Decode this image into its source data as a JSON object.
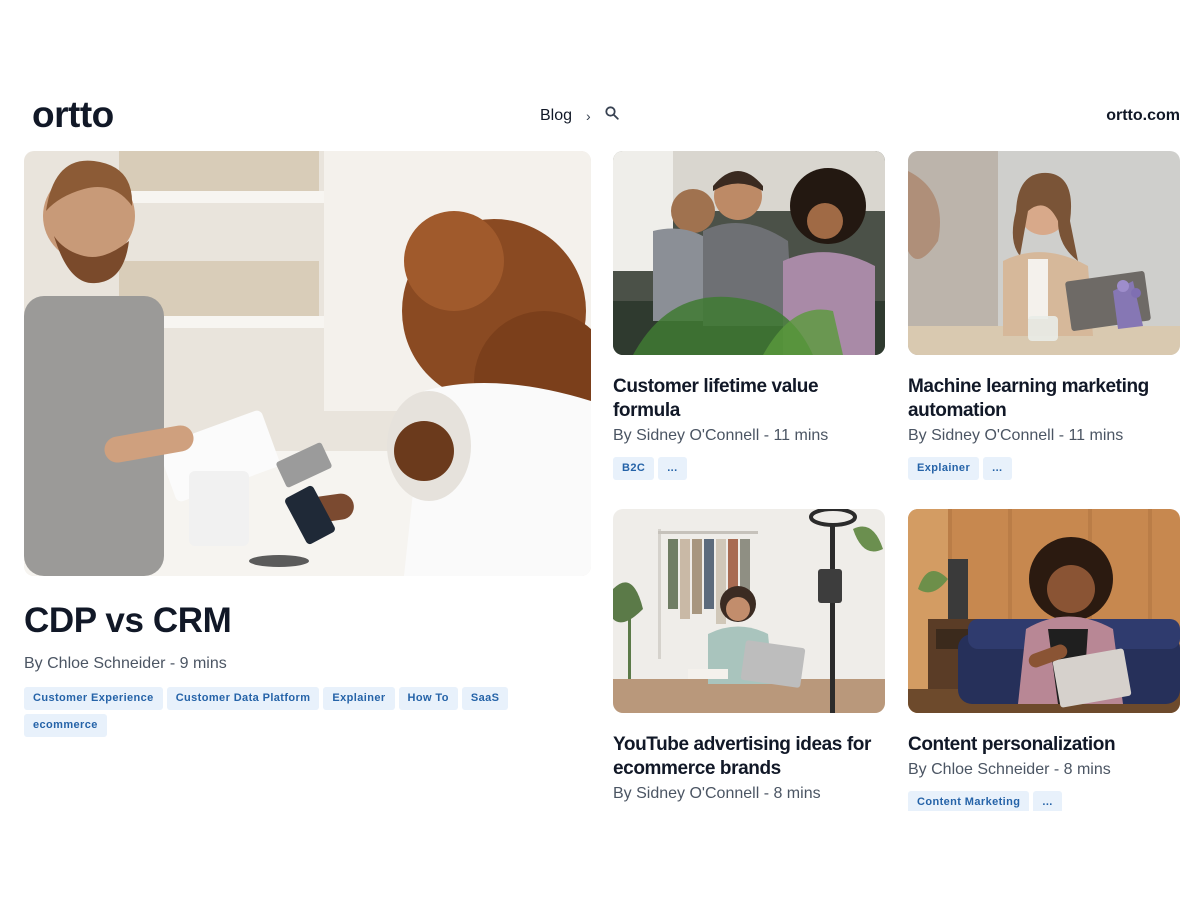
{
  "header": {
    "logo": "ortto",
    "nav_blog": "Blog",
    "nav_sep": "›",
    "site_link": "ortto.com"
  },
  "featured": {
    "title": "CDP vs CRM",
    "meta": "By Chloe Schneider - 9 mins",
    "tags": [
      "Customer Experience",
      "Customer Data Platform",
      "Explainer",
      "How To",
      "SaaS",
      "ecommerce"
    ]
  },
  "cards": [
    {
      "title": "Customer lifetime value formula",
      "meta": "By Sidney O'Connell - 11 mins",
      "tags": [
        "B2C",
        "..."
      ]
    },
    {
      "title": "Machine learning marketing automation",
      "meta": "By Sidney O'Connell - 11 mins",
      "tags": [
        "Explainer",
        "..."
      ]
    },
    {
      "title": "YouTube advertising ideas for ecommerce brands",
      "meta": "By Sidney O'Connell - 8 mins",
      "tags": []
    },
    {
      "title": "Content personalization",
      "meta": "By Chloe Schneider - 8 mins",
      "tags": [
        "Content Marketing",
        "..."
      ]
    }
  ]
}
